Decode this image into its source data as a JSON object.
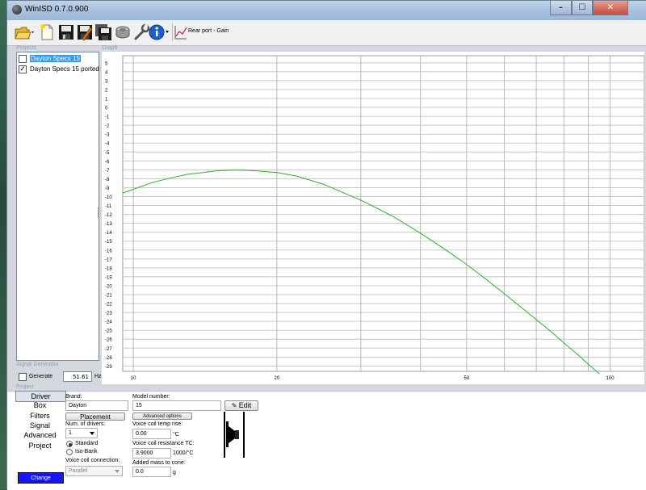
{
  "window": {
    "title": "WinISD 0.7.0.900"
  },
  "caption_buttons": {
    "minimize": "–",
    "maximize": "☐",
    "close": "✕"
  },
  "toolbar": {
    "buttons": [
      "open-folder",
      "new-document",
      "save",
      "save-as",
      "save-all",
      "driver-database",
      "tools",
      "info",
      "rear-port-gain-chart"
    ],
    "rear_port_label": "Rear port - Gain"
  },
  "panels": {
    "projects_label": "Projects",
    "graph_label": "Graph",
    "signal_generator_label": "Signal Generator",
    "project_label": "Project"
  },
  "projects": [
    {
      "name": "Dayton Specs 15",
      "checked": false,
      "selected": true
    },
    {
      "name": "Dayton Specs 15 ported",
      "checked": true,
      "selected": false
    }
  ],
  "signal_generator": {
    "generate_label": "Generate",
    "frequency": "51.61",
    "unit": "Hz"
  },
  "chart_data": {
    "type": "line",
    "title": "",
    "xscale": "log",
    "xlim": [
      9.5,
      118
    ],
    "ylim": [
      -29.6,
      5.8
    ],
    "x_ticks": [
      10,
      20,
      50,
      100
    ],
    "x_gridlines": [
      10,
      20,
      30,
      40,
      50,
      60,
      70,
      80,
      90,
      100
    ],
    "y_ticks": [
      5,
      4,
      3,
      2,
      1,
      0,
      -1,
      -2,
      -3,
      -4,
      -5,
      -6,
      -7,
      -8,
      -9,
      -10,
      -11,
      -12,
      -13,
      -14,
      -15,
      -16,
      -17,
      -18,
      -19,
      -20,
      -21,
      -22,
      -23,
      -24,
      -25,
      -26,
      -27,
      -28,
      -29
    ],
    "grid": true,
    "series": [
      {
        "color": "#33aa33",
        "points": [
          [
            9.5,
            -9.6
          ],
          [
            11,
            -8.4
          ],
          [
            12,
            -7.9
          ],
          [
            13,
            -7.5
          ],
          [
            14,
            -7.3
          ],
          [
            15,
            -7.1
          ],
          [
            16,
            -7.05
          ],
          [
            17,
            -7.05
          ],
          [
            18,
            -7.1
          ],
          [
            19,
            -7.2
          ],
          [
            20,
            -7.3
          ],
          [
            22,
            -7.7
          ],
          [
            25,
            -8.6
          ],
          [
            30,
            -10.4
          ],
          [
            35,
            -12.2
          ],
          [
            40,
            -14.1
          ],
          [
            45,
            -15.9
          ],
          [
            50,
            -17.6
          ],
          [
            55,
            -19.3
          ],
          [
            60,
            -20.9
          ],
          [
            65,
            -22.4
          ],
          [
            70,
            -23.8
          ],
          [
            75,
            -25.1
          ],
          [
            80,
            -26.4
          ],
          [
            85,
            -27.6
          ],
          [
            90,
            -28.8
          ],
          [
            95,
            -29.9
          ]
        ]
      }
    ]
  },
  "project_nav": {
    "items": [
      "Driver",
      "Box",
      "Filters",
      "Signal",
      "Advanced",
      "Project"
    ],
    "change_label": "Change"
  },
  "driver_form": {
    "brand_label": "Brand:",
    "brand_value": "Dayton",
    "model_label": "Model number:",
    "model_value": "15",
    "edit_label": "Edit",
    "placement_label": "Placement",
    "num_drivers_label": "Num. of drivers:",
    "num_drivers_value": "1",
    "standard_label": "Standard",
    "isobarik_label": "Iso-Barik",
    "vc_connection_label": "Voice coil connection:",
    "vc_connection_value": "Parallel",
    "advanced_options_label": "Advanced options",
    "vc_temp_rise_label": "Voice coil temp rise:",
    "vc_temp_rise_value": "0.00",
    "vc_temp_rise_unit": "°C",
    "vc_resistance_tc_label": "Voice coil resistance TC:",
    "vc_resistance_tc_value": "3.9000",
    "vc_resistance_tc_unit": "1000/°C",
    "added_mass_label": "Added mass to cone:",
    "added_mass_value": "0.0",
    "added_mass_unit": "g"
  }
}
